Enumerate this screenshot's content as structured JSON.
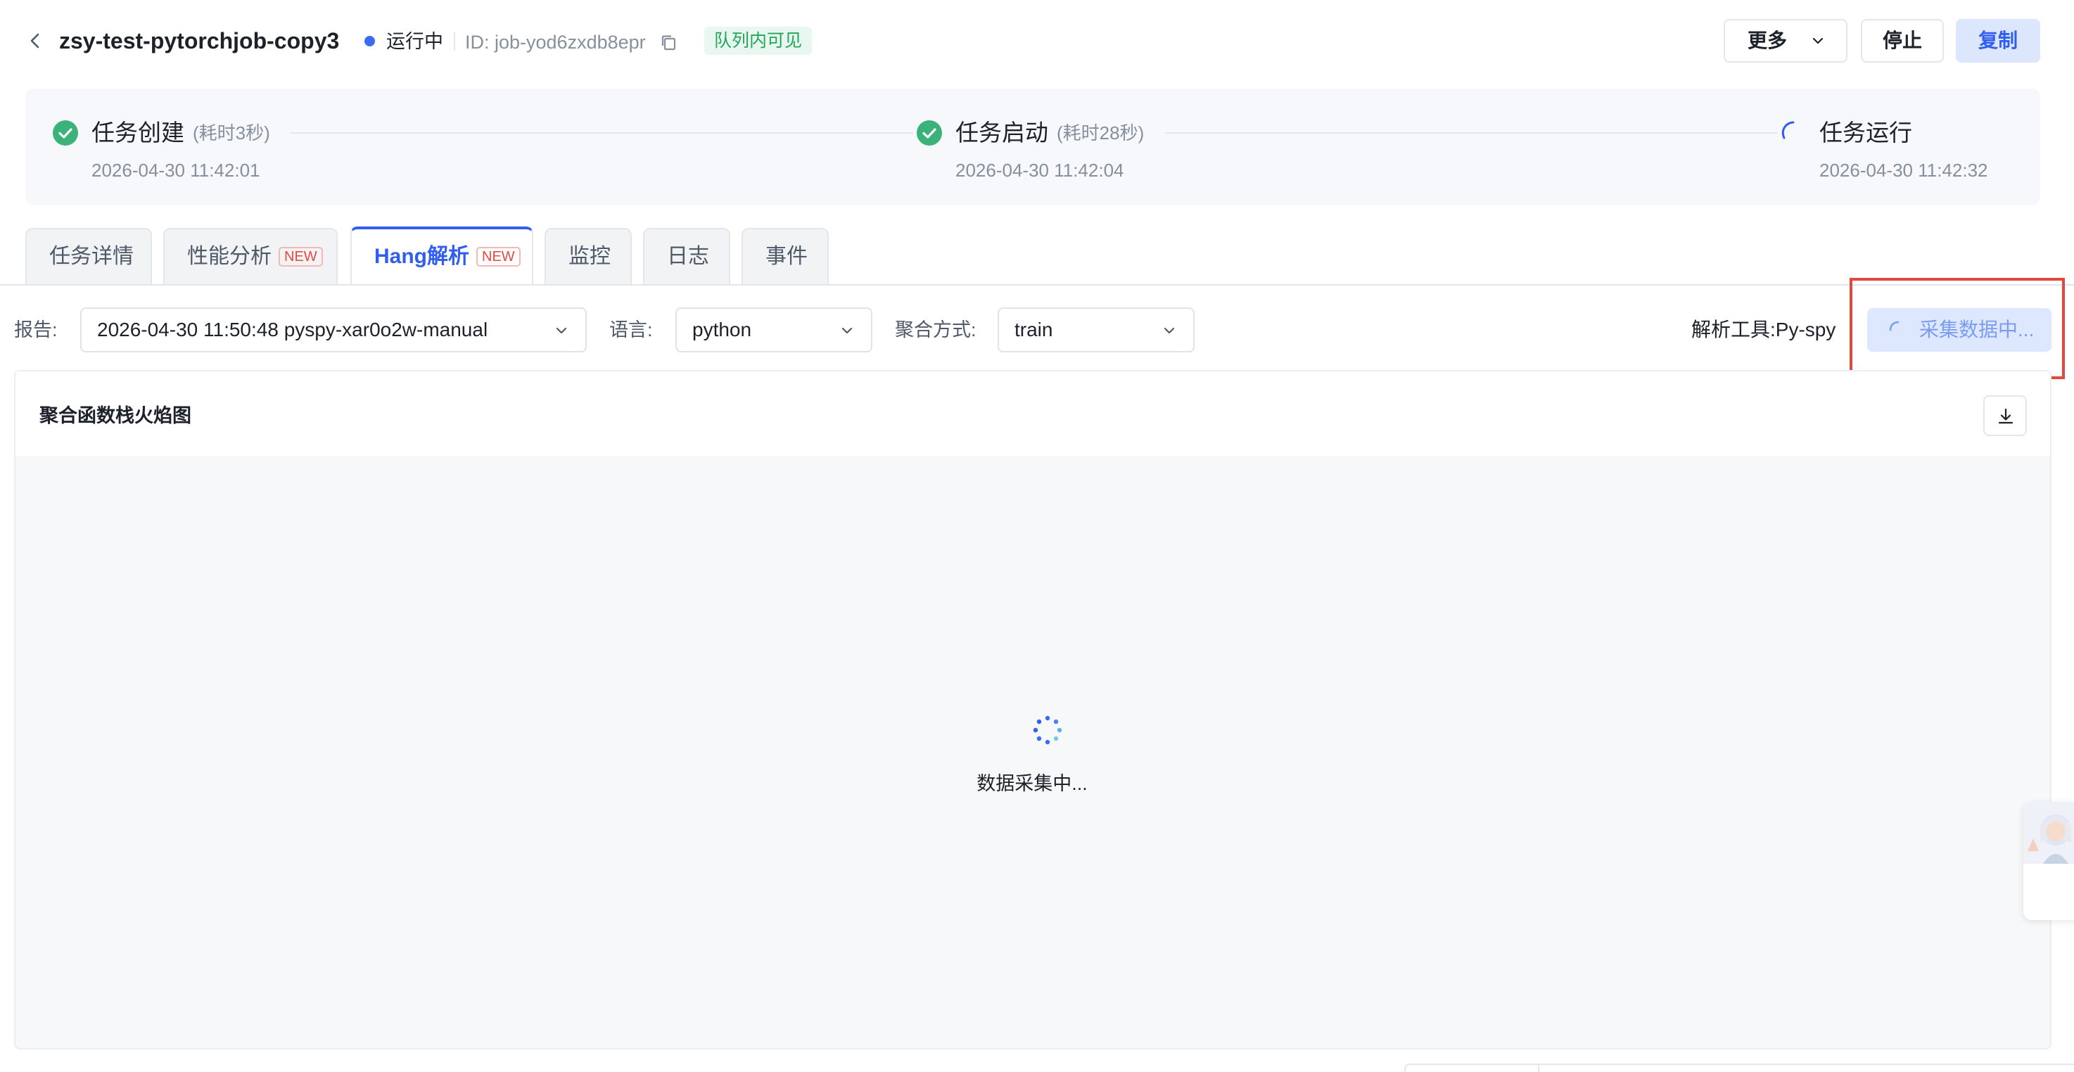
{
  "header": {
    "job_name": "zsy-test-pytorchjob-copy3",
    "status": "运行中",
    "job_id": "ID: job-yod6zxdb8epr",
    "visibility_tag": "队列内可见",
    "buttons": {
      "more": "更多",
      "stop": "停止",
      "copy": "复制"
    },
    "icons": {
      "back": "chevron-left-icon",
      "copy_id": "copy-icon",
      "more_chevron": "chevron-down-icon"
    },
    "colors": {
      "status_dot": "#3b6af3",
      "accent": "#2f5ef0",
      "tag_text": "#23a55a"
    }
  },
  "steps": [
    {
      "title": "任务创建",
      "duration": "(耗时3秒)",
      "time": "2026-04-30 11:42:01",
      "state": "done"
    },
    {
      "title": "任务启动",
      "duration": "(耗时28秒)",
      "time": "2026-04-30 11:42:04",
      "state": "done"
    },
    {
      "title": "任务运行",
      "duration": "",
      "time": "2026-04-30 11:42:32",
      "state": "in-progress"
    }
  ],
  "tabs": [
    {
      "label": "任务详情",
      "badge": ""
    },
    {
      "label": "性能分析",
      "badge": "NEW"
    },
    {
      "label": "Hang解析",
      "badge": "NEW",
      "active": true
    },
    {
      "label": "监控",
      "badge": ""
    },
    {
      "label": "日志",
      "badge": ""
    },
    {
      "label": "事件",
      "badge": ""
    }
  ],
  "filters": {
    "report_label": "报告:",
    "report_value": "2026-04-30 11:50:48 pyspy-xar0o2w-manual",
    "language_label": "语言:",
    "language_value": "python",
    "aggregation_label": "聚合方式:",
    "aggregation_value": "train",
    "tool_label": "解析工具:Py-spy",
    "collect_button": "采集数据中..."
  },
  "flame_graph": {
    "title": "聚合函数栈火焰图",
    "loading_text": "数据采集中...",
    "download_icon": "download-icon"
  },
  "assistant": {
    "icon": "assistant-avatar-icon"
  }
}
